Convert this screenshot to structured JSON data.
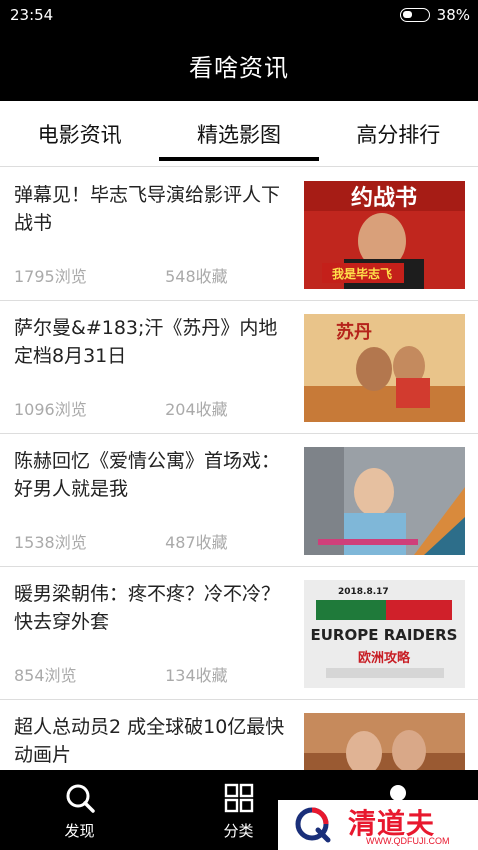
{
  "status": {
    "time": "23:54",
    "battery": "38%",
    "battery_level": 0.38
  },
  "app": {
    "title": "看啥资讯"
  },
  "tabs": [
    {
      "label": "电影资讯",
      "active": false
    },
    {
      "label": "精选影图",
      "active": true
    },
    {
      "label": "高分排行",
      "active": false
    }
  ],
  "news": [
    {
      "title": "弹幕见！毕志飞导演给影评人下战书",
      "views": "1795浏览",
      "favorites": "548收藏",
      "thumb_caption": "约战书",
      "thumb_sub": "我是毕志飞",
      "thumb_color": "#c0261e"
    },
    {
      "title": "萨尔曼&#183;汗《苏丹》内地定档8月31日",
      "views": "1096浏览",
      "favorites": "204收藏",
      "thumb_caption": "苏丹",
      "thumb_color": "#d88a3c"
    },
    {
      "title": "陈赫回忆《爱情公寓》首场戏：好男人就是我",
      "views": "1538浏览",
      "favorites": "487收藏",
      "thumb_caption": "",
      "thumb_color": "#8b8f96"
    },
    {
      "title": "暖男梁朝伟：疼不疼？冷不冷？快去穿外套",
      "views": "854浏览",
      "favorites": "134收藏",
      "thumb_caption": "EUROPE RAIDERS",
      "thumb_date": "2018.8.17",
      "thumb_sub": "欧洲攻略",
      "thumb_color": "#f0f0f0"
    },
    {
      "title": "超人总动员2  成全球破10亿最快动画片",
      "views": "",
      "favorites": "",
      "thumb_caption": "",
      "thumb_color": "#8a4a2a"
    }
  ],
  "bottom_nav": [
    {
      "label": "发现",
      "icon": "search-icon"
    },
    {
      "label": "分类",
      "icon": "grid-icon"
    },
    {
      "label": "",
      "icon": "profile-icon"
    }
  ],
  "watermark": {
    "text": "清道夫",
    "url": "WWW.QDFUJI.COM"
  }
}
